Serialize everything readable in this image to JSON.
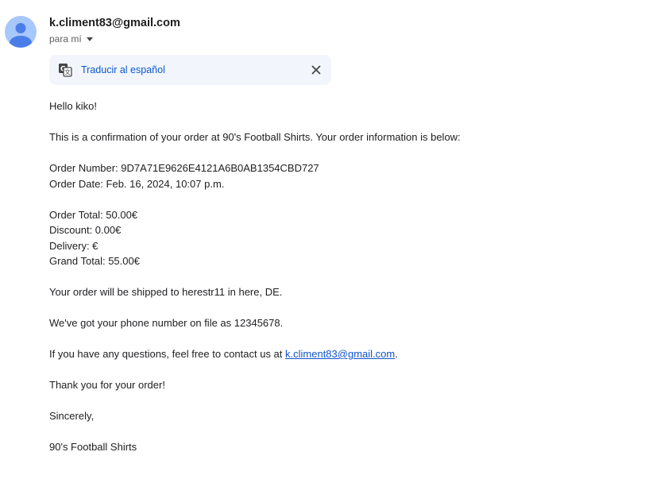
{
  "sender": {
    "email": "k.climent83@gmail.com"
  },
  "recipient": {
    "label": "para mí"
  },
  "translate_banner": {
    "link_label": "Traducir al español"
  },
  "message": {
    "greeting": "Hello kiko!",
    "intro": "This is a confirmation of your order at 90's Football Shirts. Your order information is below:",
    "order_number": "Order Number: 9D7A71E9626E4121A6B0AB1354CBD727",
    "order_date": "Order Date: Feb. 16, 2024, 10:07 p.m.",
    "order_total": "Order Total: 50.00€",
    "discount": "Discount: 0.00€",
    "delivery": "Delivery: €",
    "grand_total": "Grand Total: 55.00€",
    "shipping": "Your order will be shipped to herestr11 in here, DE.",
    "phone": "We've got your phone number on file as 12345678.",
    "contact_prefix": "If you have any questions, feel free to contact us at ",
    "contact_email": "k.climent83@gmail.com",
    "contact_suffix": ".",
    "thanks": "Thank you for your order!",
    "sign_off": "Sincerely,",
    "signature": "90's Football Shirts"
  },
  "icons": {
    "avatar": "default-avatar-icon",
    "recipient_dropdown": "chevron-down-icon",
    "translate": "translate-icon",
    "close": "close-icon"
  },
  "colors": {
    "avatar_bg": "#a8c7fa",
    "avatar_figure": "#4a7de8",
    "link": "#0b57d0",
    "banner_bg": "#f2f6fc"
  }
}
